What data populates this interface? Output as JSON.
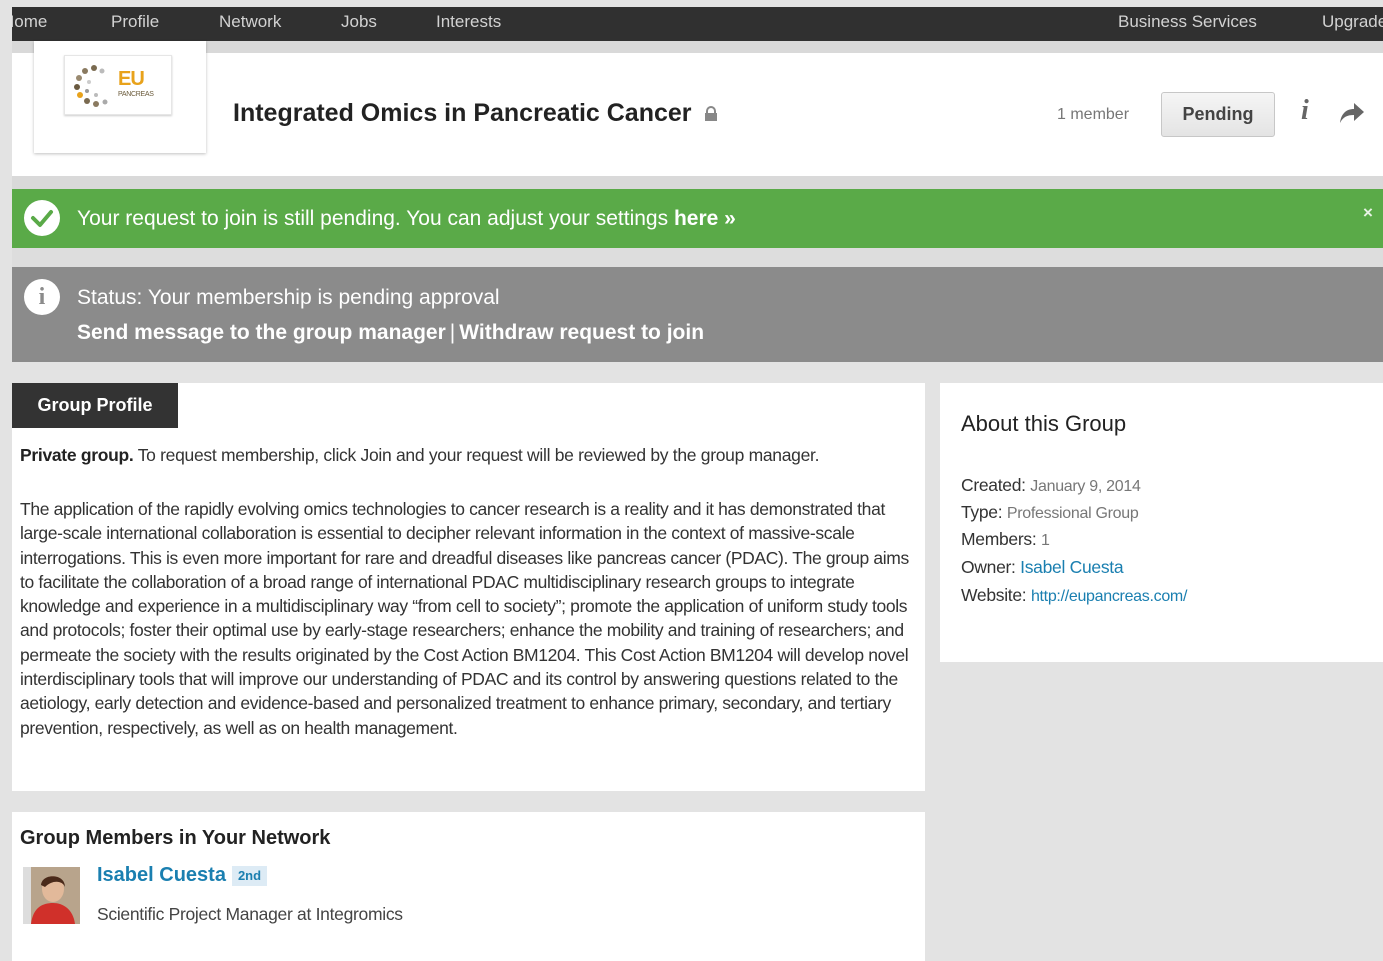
{
  "nav": {
    "left": [
      "Home",
      "Profile",
      "Network",
      "Jobs",
      "Interests"
    ],
    "business": "Business Services",
    "upgrade": "Upgrade"
  },
  "logo": {
    "text": "EU",
    "sub": "PANCREAS"
  },
  "group": {
    "title": "Integrated Omics in Pancreatic Cancer",
    "member_count": "1 member",
    "pending_label": "Pending"
  },
  "success_banner": {
    "text": "Your request to join is still pending. You can adjust your settings ",
    "link": "here »",
    "close": "×"
  },
  "status_banner": {
    "status": "Status: Your membership is pending approval",
    "send_message": "Send message to the group manager",
    "separator": "|",
    "withdraw": "Withdraw request to join"
  },
  "profile": {
    "tab": "Group Profile",
    "private_label": "Private group.",
    "private_text": " To request membership, click Join and your request will be reviewed by the group manager.",
    "description": "The application of the rapidly evolving omics technologies to cancer research is a reality and it has demonstrated that large-scale international collaboration is essential to decipher relevant information in the context of massive-scale interrogations. This is even more important for rare and dreadful diseases like pancreas cancer (PDAC). The group aims to facilitate the collaboration of a broad range of international PDAC multidisciplinary research groups to integrate knowledge and experience in a multidisciplinary way “from cell to society”; promote the application of uniform study tools and protocols; foster their optimal use by early-stage researchers; enhance the mobility and training of researchers; and permeate the society with the results originated by the Cost Action BM1204. This Cost Action BM1204 will develop novel interdisciplinary tools that will improve our understanding of PDAC and its control by answering questions related to the aetiology, early detection and evidence-based and personalized treatment to enhance primary, secondary, and tertiary prevention, respectively, as well as on health management."
  },
  "members": {
    "title": "Group Members in Your Network",
    "list": [
      {
        "name": "Isabel Cuesta",
        "degree": "2nd",
        "headline": "Scientific Project Manager at Integromics"
      }
    ]
  },
  "about": {
    "title": "About this Group",
    "created_label": "Created:",
    "created": "January 9, 2014",
    "type_label": "Type:",
    "type": "Professional Group",
    "members_label": "Members:",
    "members": "1",
    "owner_label": "Owner:",
    "owner": "Isabel Cuesta",
    "website_label": "Website:",
    "website": "http://eupancreas.com/"
  },
  "colors": {
    "nav_bg": "#303030",
    "success_green": "#5aaa48",
    "status_gray": "#8b8b8b",
    "link_blue": "#1a7fb0"
  }
}
